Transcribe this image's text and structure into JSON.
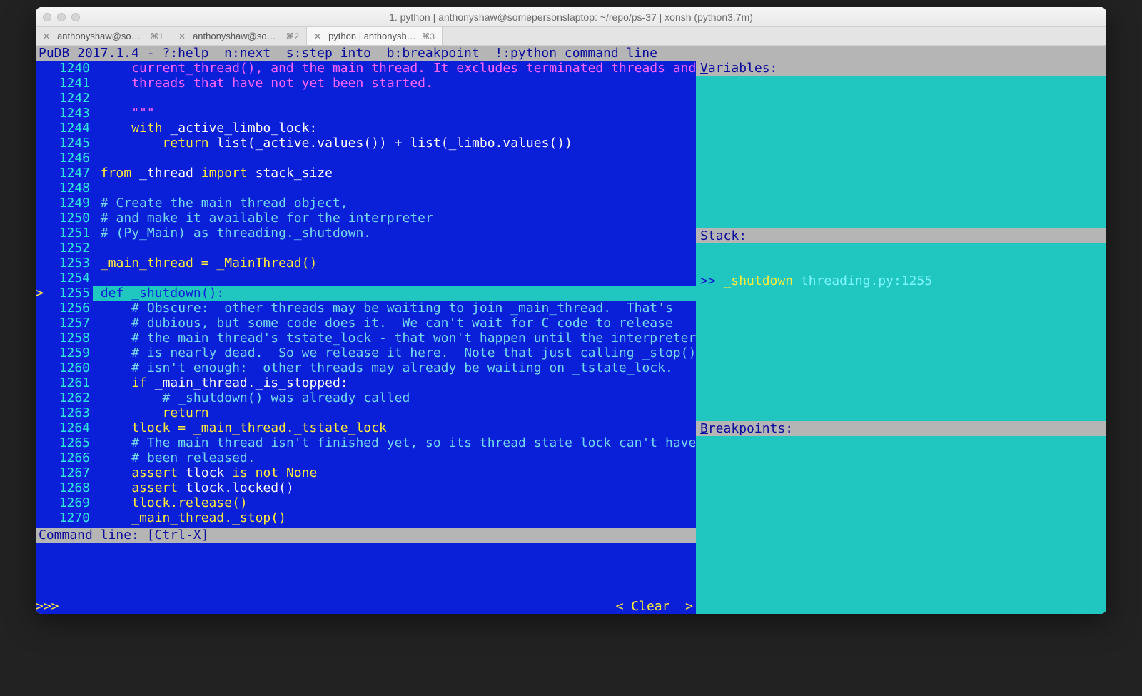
{
  "window": {
    "title": "1. python | anthonyshaw@somepersonslaptop: ~/repo/ps-37 | xonsh (python3.7m)"
  },
  "tabs": [
    {
      "label": "anthonyshaw@some…",
      "shortcut": "⌘1",
      "active": false
    },
    {
      "label": "anthonyshaw@some…",
      "shortcut": "⌘2",
      "active": false
    },
    {
      "label": "python | anthonysha…",
      "shortcut": "⌘3",
      "active": true
    }
  ],
  "helpbar": "PuDB 2017.1.4 - ?:help  n:next  s:step into  b:breakpoint  !:python command line",
  "side": {
    "variables_label": "Variables:",
    "stack_label": "Stack:",
    "breakpoints_label": "Breakpoints:",
    "stack_marker": ">>",
    "stack_func": "_shutdown",
    "stack_file": "threading.py:1255"
  },
  "cmdline_label": "Command line: [Ctrl-X]",
  "repl": {
    "prompt": ">>>",
    "clear": "< Clear  >"
  },
  "code": [
    {
      "n": 1240,
      "m": "",
      "segs": [
        [
          "    ",
          ""
        ],
        [
          "current_thread(), and the main thread. It excludes terminated threads and",
          "mg"
        ]
      ]
    },
    {
      "n": 1241,
      "m": "",
      "segs": [
        [
          "    ",
          ""
        ],
        [
          "threads that have not yet been started.",
          "mg"
        ]
      ]
    },
    {
      "n": 1242,
      "m": "",
      "segs": [
        [
          "",
          ""
        ]
      ]
    },
    {
      "n": 1243,
      "m": "",
      "segs": [
        [
          "    ",
          ""
        ],
        [
          "\"\"\"",
          "mg"
        ]
      ]
    },
    {
      "n": 1244,
      "m": "",
      "segs": [
        [
          "    ",
          ""
        ],
        [
          "with",
          "kw"
        ],
        [
          " _active_limbo_lock:",
          ""
        ]
      ]
    },
    {
      "n": 1245,
      "m": "",
      "segs": [
        [
          "        ",
          ""
        ],
        [
          "return",
          "kw"
        ],
        [
          " list(_active.values()) + list(_limbo.values())",
          ""
        ]
      ]
    },
    {
      "n": 1246,
      "m": "",
      "segs": [
        [
          "",
          ""
        ]
      ]
    },
    {
      "n": 1247,
      "m": "",
      "segs": [
        [
          "from",
          "kw"
        ],
        [
          " _thread ",
          ""
        ],
        [
          "import",
          "kw"
        ],
        [
          " stack_size",
          ""
        ]
      ]
    },
    {
      "n": 1248,
      "m": "",
      "segs": [
        [
          "",
          ""
        ]
      ]
    },
    {
      "n": 1249,
      "m": "",
      "segs": [
        [
          "# Create the main thread object,",
          "cm"
        ]
      ]
    },
    {
      "n": 1250,
      "m": "",
      "segs": [
        [
          "# and make it available for the interpreter",
          "cm"
        ]
      ]
    },
    {
      "n": 1251,
      "m": "",
      "segs": [
        [
          "# (Py_Main) as threading._shutdown.",
          "cm"
        ]
      ]
    },
    {
      "n": 1252,
      "m": "",
      "segs": [
        [
          "",
          ""
        ]
      ]
    },
    {
      "n": 1253,
      "m": "",
      "segs": [
        [
          "_main_thread = _MainThread()",
          "kw"
        ]
      ]
    },
    {
      "n": 1254,
      "m": "",
      "segs": [
        [
          "",
          ""
        ]
      ]
    },
    {
      "n": 1255,
      "m": ">",
      "cur": true,
      "segs": [
        [
          "def",
          "kw"
        ],
        [
          " _shutdown():",
          ""
        ]
      ]
    },
    {
      "n": 1256,
      "m": "",
      "segs": [
        [
          "    ",
          ""
        ],
        [
          "# Obscure:  other threads may be waiting to join _main_thread.  That's",
          "cm"
        ]
      ]
    },
    {
      "n": 1257,
      "m": "",
      "segs": [
        [
          "    ",
          ""
        ],
        [
          "# dubious, but some code does it.  We can't wait for C code to release",
          "cm"
        ]
      ]
    },
    {
      "n": 1258,
      "m": "",
      "segs": [
        [
          "    ",
          ""
        ],
        [
          "# the main thread's tstate_lock - that won't happen until the interpreter",
          "cm"
        ]
      ]
    },
    {
      "n": 1259,
      "m": "",
      "segs": [
        [
          "    ",
          ""
        ],
        [
          "# is nearly dead.  So we release it here.  Note that just calling _stop()",
          "cm"
        ]
      ]
    },
    {
      "n": 1260,
      "m": "",
      "segs": [
        [
          "    ",
          ""
        ],
        [
          "# isn't enough:  other threads may already be waiting on _tstate_lock.",
          "cm"
        ]
      ]
    },
    {
      "n": 1261,
      "m": "",
      "segs": [
        [
          "    ",
          ""
        ],
        [
          "if",
          "kw"
        ],
        [
          " _main_thread._is_stopped:",
          ""
        ]
      ]
    },
    {
      "n": 1262,
      "m": "",
      "segs": [
        [
          "        ",
          ""
        ],
        [
          "# _shutdown() was already called",
          "cm"
        ]
      ]
    },
    {
      "n": 1263,
      "m": "",
      "segs": [
        [
          "        ",
          ""
        ],
        [
          "return",
          "kw"
        ]
      ]
    },
    {
      "n": 1264,
      "m": "",
      "segs": [
        [
          "    tlock = _main_thread._tstate_lock",
          "kw"
        ]
      ]
    },
    {
      "n": 1265,
      "m": "",
      "segs": [
        [
          "    ",
          ""
        ],
        [
          "# The main thread isn't finished yet, so its thread state lock can't have",
          "cm"
        ]
      ]
    },
    {
      "n": 1266,
      "m": "",
      "segs": [
        [
          "    ",
          ""
        ],
        [
          "# been released.",
          "cm"
        ]
      ]
    },
    {
      "n": 1267,
      "m": "",
      "segs": [
        [
          "    ",
          ""
        ],
        [
          "assert",
          "kw"
        ],
        [
          " tlock ",
          ""
        ],
        [
          "is not",
          "kw"
        ],
        [
          " ",
          ""
        ],
        [
          "None",
          "kw"
        ]
      ]
    },
    {
      "n": 1268,
      "m": "",
      "segs": [
        [
          "    ",
          ""
        ],
        [
          "assert",
          "kw"
        ],
        [
          " tlock.locked()",
          ""
        ]
      ]
    },
    {
      "n": 1269,
      "m": "",
      "segs": [
        [
          "    tlock.release()",
          "kw"
        ]
      ]
    },
    {
      "n": 1270,
      "m": "",
      "segs": [
        [
          "    _main_thread._stop()",
          "kw"
        ]
      ]
    }
  ]
}
